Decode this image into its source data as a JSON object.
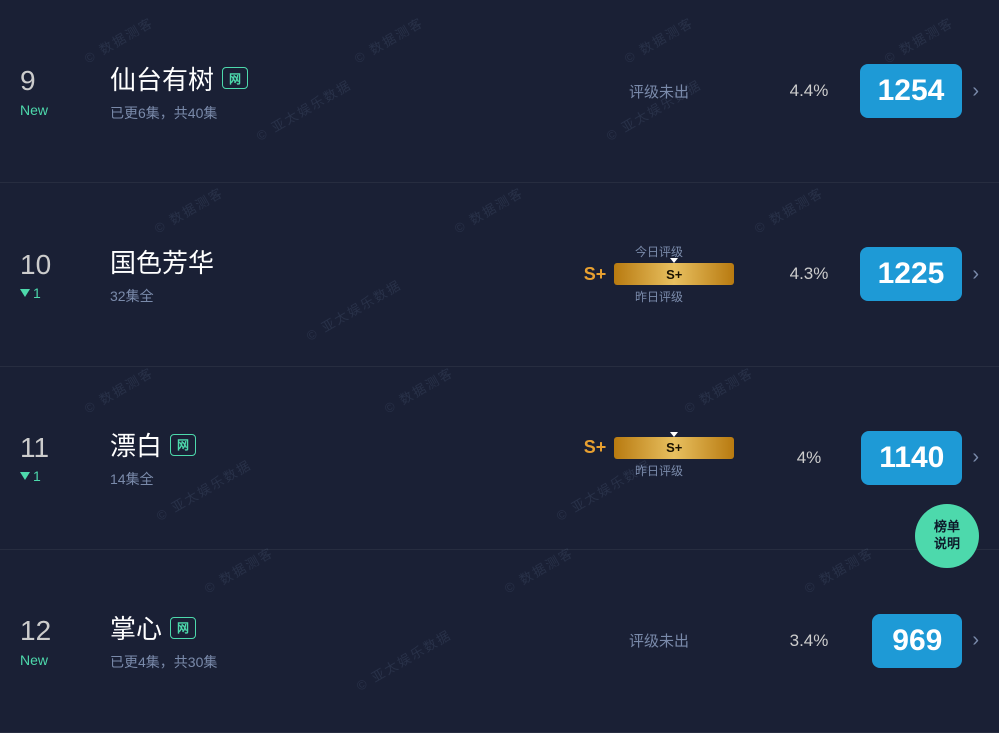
{
  "items": [
    {
      "rank": "9",
      "change_type": "new",
      "change_label": "New",
      "title": "仙台有树",
      "platform": "网",
      "subtitle": "已更6集，共40集",
      "rating_type": "no_data",
      "rating_text": "评级未出",
      "percent": "4.4%",
      "score": "1254"
    },
    {
      "rank": "10",
      "change_type": "down",
      "change_label": "1",
      "title": "国色芳华",
      "platform": null,
      "subtitle": "32集全",
      "rating_type": "bar",
      "rating_grade": "S+",
      "rating_bar_label": "S+",
      "label_top": "今日评级",
      "label_bottom": "昨日评级",
      "percent": "4.3%",
      "score": "1225"
    },
    {
      "rank": "11",
      "change_type": "down",
      "change_label": "1",
      "title": "漂白",
      "platform": "网",
      "subtitle": "14集全",
      "rating_type": "bar_bottom",
      "rating_grade": "S+",
      "rating_bar_label": "S+",
      "label_bottom": "昨日评级",
      "percent": "4%",
      "score": "1140"
    },
    {
      "rank": "12",
      "change_type": "new",
      "change_label": "New",
      "title": "掌心",
      "platform": "网",
      "subtitle": "已更4集，共30集",
      "rating_type": "no_data",
      "rating_text": "评级未出",
      "percent": "3.4%",
      "score": "969"
    }
  ],
  "fab": {
    "line1": "榜单",
    "line2": "说明"
  }
}
